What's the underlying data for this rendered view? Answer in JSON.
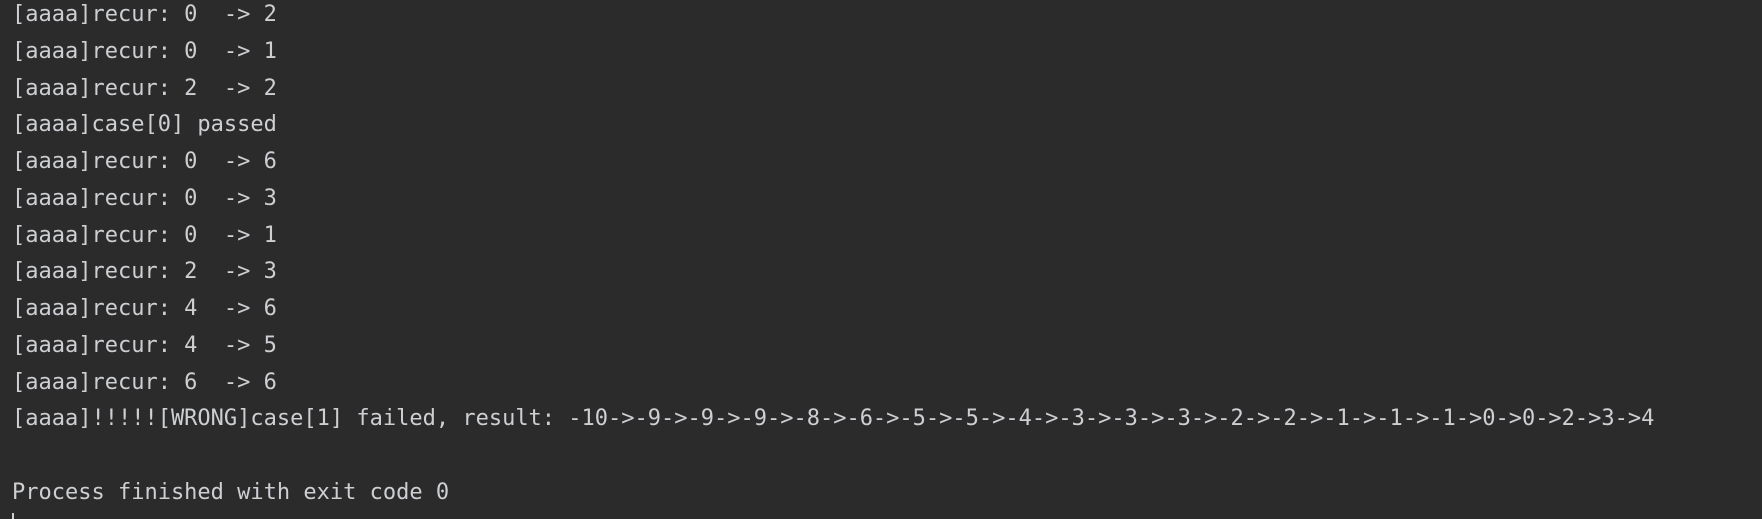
{
  "console": {
    "lines": [
      "[aaaa]recur: 0  -> 2",
      "[aaaa]recur: 0  -> 1",
      "[aaaa]recur: 2  -> 2",
      "[aaaa]case[0] passed",
      "[aaaa]recur: 0  -> 6",
      "[aaaa]recur: 0  -> 3",
      "[aaaa]recur: 0  -> 1",
      "[aaaa]recur: 2  -> 3",
      "[aaaa]recur: 4  -> 6",
      "[aaaa]recur: 4  -> 5",
      "[aaaa]recur: 6  -> 6",
      "[aaaa]!!!!![WRONG]case[1] failed, result: -10->-9->-9->-9->-8->-6->-5->-5->-4->-3->-3->-3->-2->-2->-1->-1->-1->0->0->2->3->4",
      "",
      "Process finished with exit code 0"
    ]
  },
  "colors": {
    "background": "#2b2b2b",
    "text": "#cdcfd3"
  }
}
